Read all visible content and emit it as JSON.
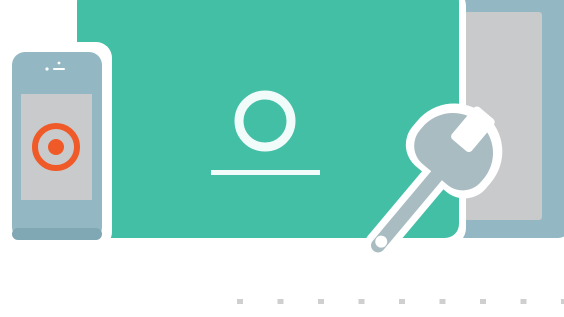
{
  "illustration": {
    "icons": {
      "phone": "smartphone-icon",
      "phone_target": "target-icon",
      "tablet": "tablet-icon",
      "profile": "user-profile-icon",
      "back_tablet": "tablet-icon",
      "wrench": "wrench-icon"
    },
    "colors": {
      "teal": "#43bfa6",
      "slate": "#93b8c4",
      "slate_dark": "#7fa7b4",
      "screen_gray": "#c9cacc",
      "accent_orange": "#f05a28",
      "white": "#ffffff",
      "wrench_gray": "#a9bcc2",
      "dots": "#cfcfcf"
    },
    "pager_dot_count": 9
  }
}
